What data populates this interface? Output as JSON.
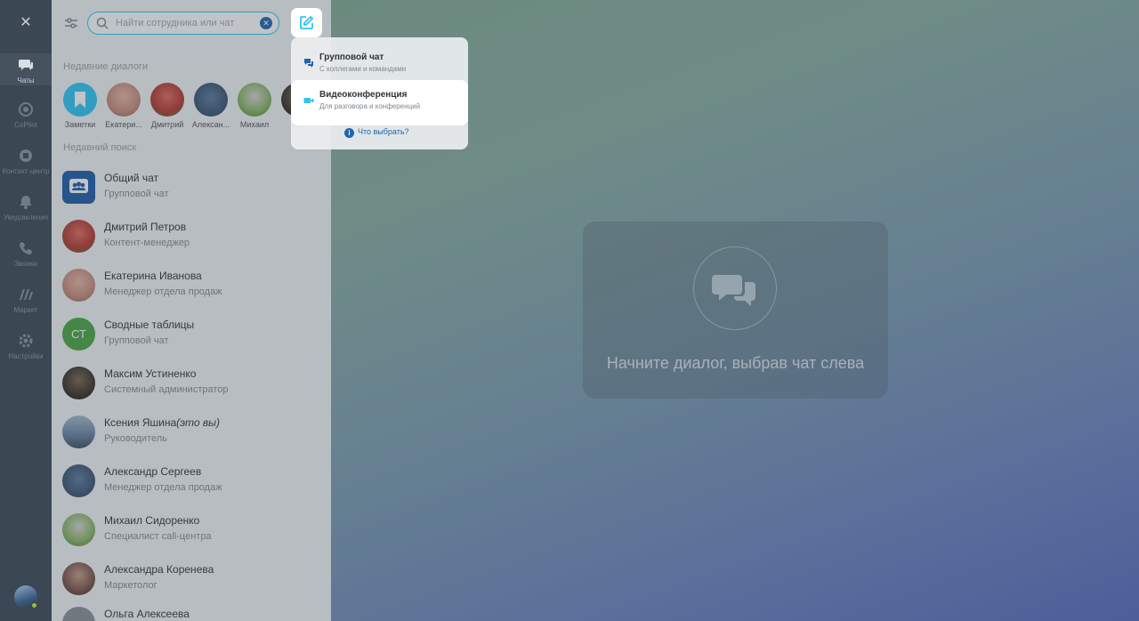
{
  "rail": {
    "items": [
      {
        "label": "Чаты",
        "icon": "chats-icon"
      },
      {
        "label": "CoPilot",
        "icon": "copilot-icon"
      },
      {
        "label": "Контакт-центр",
        "icon": "contact-center-icon"
      },
      {
        "label": "Уведомления",
        "icon": "bell-icon"
      },
      {
        "label": "Звонки",
        "icon": "phone-icon"
      },
      {
        "label": "Маркет",
        "icon": "market-icon"
      },
      {
        "label": "Настройки",
        "icon": "gear-icon"
      }
    ]
  },
  "search": {
    "placeholder": "Найти сотрудника или чат"
  },
  "recent_dialogs": {
    "title": "Недавние диалоги",
    "items": [
      {
        "name": "Заметки",
        "color": "#2fc6f6"
      },
      {
        "name": "Екатери...",
        "color": "#c98a7a"
      },
      {
        "name": "Дмитрий",
        "color": "#b3362e"
      },
      {
        "name": "Алексан...",
        "color": "#3d5577"
      },
      {
        "name": "Михаил",
        "color": "#6e9b4c"
      },
      {
        "name": "Ма",
        "color": "#3a2f27"
      }
    ]
  },
  "recent_search": {
    "title": "Недавний поиск",
    "items": [
      {
        "title": "Общий чат",
        "sub": "Групповой чат",
        "color": "#1f5aa8"
      },
      {
        "title": "Дмитрий Петров",
        "sub": "Контент-менеджер",
        "color": "#b3362e"
      },
      {
        "title": "Екатерина Иванова",
        "sub": "Менеджер отдела продаж",
        "color": "#c98a7a"
      },
      {
        "title": "Сводные таблицы",
        "sub": "Групповой чат",
        "initials": "СТ",
        "color": "#49a643"
      },
      {
        "title": "Максим Устиненко",
        "sub": "Системный администратор",
        "color": "#3a2f27"
      },
      {
        "title": "Ксения Яшина",
        "title_suffix": "(это вы)",
        "sub": "Руководитель",
        "color": "#6d86a6"
      },
      {
        "title": "Александр Сергеев",
        "sub": "Менеджер отдела продаж",
        "color": "#3d5577"
      },
      {
        "title": "Михаил Сидоренко",
        "sub": "Специалист call-центра",
        "color": "#6e9b4c"
      },
      {
        "title": "Александра Коренева",
        "sub": "Маркетолог",
        "color": "#7a5048"
      },
      {
        "title": "Ольга Алексеева",
        "sub": "",
        "color": "#8b8f94"
      }
    ]
  },
  "menu": {
    "group_chat": {
      "title": "Групповой чат",
      "sub": "С коллегами и командами"
    },
    "video_conf": {
      "title": "Видеоконференция",
      "sub": "Для разговора и конференций"
    },
    "help": "Что выбрать?"
  },
  "empty_state": {
    "text": "Начните диалог, выбрав чат слева"
  },
  "colors": {
    "accent": "#2fc6f6",
    "link": "#2066b0"
  }
}
